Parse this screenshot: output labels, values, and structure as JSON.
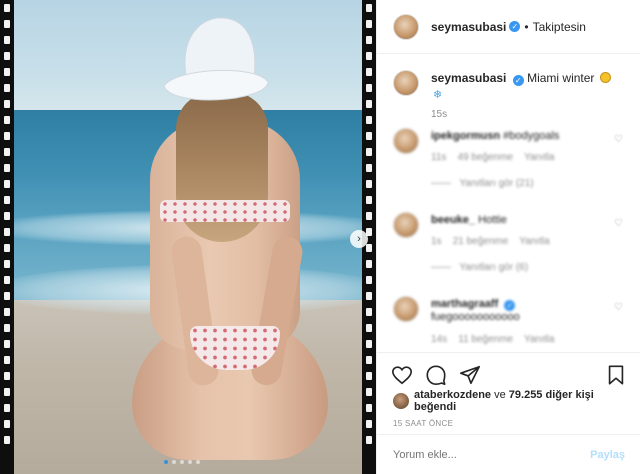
{
  "header": {
    "username": "seymasubasi",
    "dot": "•",
    "follow_status": "Takiptesin"
  },
  "caption": {
    "username": "seymasubasi",
    "text": "Miami winter",
    "time": "15s",
    "emoji_icons": [
      "sun-icon",
      "snowflake-icon"
    ]
  },
  "comments": [
    {
      "username": "ipekgormusn",
      "text": "#bodygoals",
      "time": "11s",
      "likes": "49 beğenme",
      "reply": "Yanıtla",
      "replies": "Yanıtları gör (21)"
    },
    {
      "username": "beeuke_",
      "text": "Hottie",
      "time": "1s",
      "likes": "21 beğenme",
      "reply": "Yanıtla",
      "replies": "Yanıtları gör (6)"
    },
    {
      "username": "marthagraaff",
      "text": "fuegooooooooooo",
      "time": "14s",
      "likes": "11 beğenme",
      "reply": "Yanıtla",
      "replies": ""
    }
  ],
  "likes": {
    "liker": "ataberkozdene",
    "joiner": "ve",
    "count": "79.255",
    "suffix": "diğer kişi beğendi"
  },
  "time_ago": "15 SAAT ÖNCE",
  "comment_box": {
    "placeholder": "Yorum ekle...",
    "post_label": "Paylaş"
  },
  "carousel": {
    "slide_count": 5,
    "active_index": 0
  },
  "colors": {
    "verified": "#3897f0",
    "muted": "#8e8e8e",
    "post_button": "#b2dffc"
  }
}
